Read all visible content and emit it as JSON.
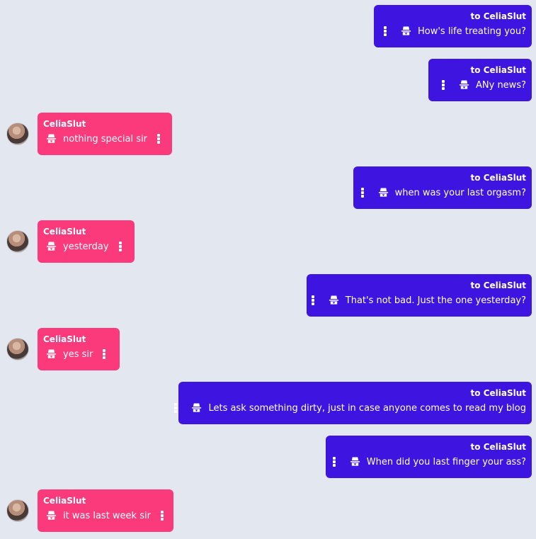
{
  "contact": "CeliaSlut",
  "to_prefix": "to CeliaSlut",
  "messages": [
    {
      "dir": "out",
      "text": "How's life treating you?"
    },
    {
      "dir": "out",
      "text": "ANy news?"
    },
    {
      "dir": "in",
      "sender": "CeliaSlut",
      "text": "nothing special sir"
    },
    {
      "dir": "out",
      "text": "when was your last orgasm?"
    },
    {
      "dir": "in",
      "sender": "CeliaSlut",
      "text": "yesterday"
    },
    {
      "dir": "out",
      "text": "That's not bad. Just the one yesterday?"
    },
    {
      "dir": "in",
      "sender": "CeliaSlut",
      "text": "yes sir"
    },
    {
      "dir": "out",
      "text": "Lets ask something dirty, just in case anyone comes to read my blog"
    },
    {
      "dir": "out",
      "text": "When did you last finger your ass?"
    },
    {
      "dir": "in",
      "sender": "CeliaSlut",
      "text": "it was last week sir"
    }
  ],
  "icons": {
    "menu": "kebab-menu-icon",
    "privacy": "spy-icon"
  },
  "colors": {
    "background": "#e3e8f0",
    "outgoing": "#3e15e0",
    "incoming": "#fb3a7b",
    "text": "#ffffff"
  }
}
